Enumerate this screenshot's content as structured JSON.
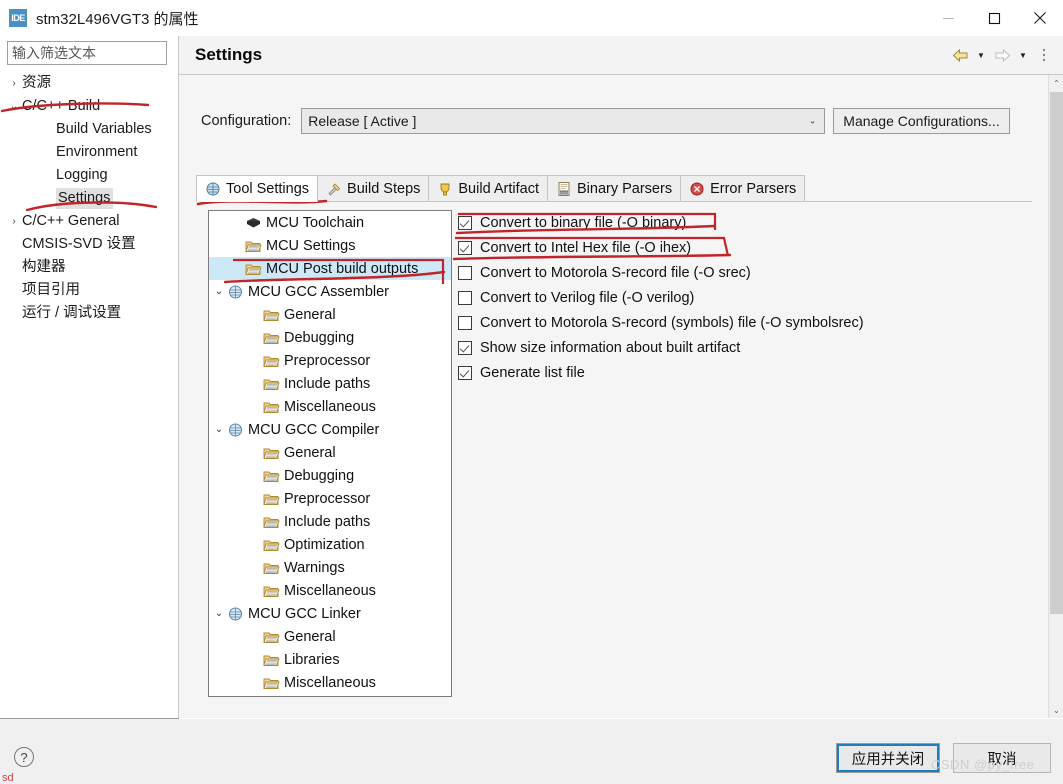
{
  "window": {
    "title": "stm32L496VGT3 的属性",
    "app_icon": "ide-icon",
    "icon_text": "IDE",
    "controls": {
      "minimize": "minimize-icon",
      "maximize": "maximize-icon",
      "close": "close-icon"
    }
  },
  "filter": {
    "placeholder": "输入筛选文本",
    "value": ""
  },
  "sidebar": {
    "items": [
      {
        "label": "资源",
        "twisty": "›",
        "indent": 0,
        "selected": false
      },
      {
        "label": "C/C++ Build",
        "twisty": "⌄",
        "indent": 0,
        "selected": false
      },
      {
        "label": "Build Variables",
        "twisty": "",
        "indent": 1,
        "selected": false
      },
      {
        "label": "Environment",
        "twisty": "",
        "indent": 1,
        "selected": false
      },
      {
        "label": "Logging",
        "twisty": "",
        "indent": 1,
        "selected": false
      },
      {
        "label": "Settings",
        "twisty": "",
        "indent": 1,
        "selected": true
      },
      {
        "label": "C/C++ General",
        "twisty": "›",
        "indent": 0,
        "selected": false
      },
      {
        "label": "CMSIS-SVD 设置",
        "twisty": "",
        "indent": 0,
        "selected": false
      },
      {
        "label": "构建器",
        "twisty": "",
        "indent": 0,
        "selected": false
      },
      {
        "label": "项目引用",
        "twisty": "",
        "indent": 0,
        "selected": false
      },
      {
        "label": "运行 / 调试设置",
        "twisty": "",
        "indent": 0,
        "selected": false
      }
    ]
  },
  "header": {
    "title": "Settings",
    "tools": [
      "back-arrow-icon",
      "back-dropdown-icon",
      "forward-arrow-icon",
      "forward-dropdown-icon",
      "view-menu-icon"
    ]
  },
  "configuration": {
    "label": "Configuration:",
    "value": "Release  [ Active ]",
    "manage_button": "Manage Configurations..."
  },
  "tabs": [
    {
      "label": "Tool Settings",
      "icon": "tool-settings-icon",
      "active": true
    },
    {
      "label": "Build Steps",
      "icon": "build-steps-icon",
      "active": false
    },
    {
      "label": "Build Artifact",
      "icon": "build-artifact-icon",
      "active": false
    },
    {
      "label": "Binary Parsers",
      "icon": "binary-parsers-icon",
      "active": false
    },
    {
      "label": "Error Parsers",
      "icon": "error-parsers-icon",
      "active": false
    }
  ],
  "tool_tree": [
    {
      "label": "MCU Toolchain",
      "twisty": "",
      "indent": 1,
      "icon": "chip-icon",
      "selected": false
    },
    {
      "label": "MCU Settings",
      "twisty": "",
      "indent": 1,
      "icon": "folder-icon",
      "selected": false
    },
    {
      "label": "MCU Post build outputs",
      "twisty": "",
      "indent": 1,
      "icon": "folder-icon",
      "selected": true
    },
    {
      "label": "MCU GCC Assembler",
      "twisty": "⌄",
      "indent": 0,
      "icon": "gcc-icon",
      "selected": false
    },
    {
      "label": "General",
      "twisty": "",
      "indent": 2,
      "icon": "folder-icon",
      "selected": false
    },
    {
      "label": "Debugging",
      "twisty": "",
      "indent": 2,
      "icon": "folder-icon",
      "selected": false
    },
    {
      "label": "Preprocessor",
      "twisty": "",
      "indent": 2,
      "icon": "folder-icon",
      "selected": false
    },
    {
      "label": "Include paths",
      "twisty": "",
      "indent": 2,
      "icon": "folder-icon",
      "selected": false
    },
    {
      "label": "Miscellaneous",
      "twisty": "",
      "indent": 2,
      "icon": "folder-icon",
      "selected": false
    },
    {
      "label": "MCU GCC Compiler",
      "twisty": "⌄",
      "indent": 0,
      "icon": "gcc-icon",
      "selected": false
    },
    {
      "label": "General",
      "twisty": "",
      "indent": 2,
      "icon": "folder-icon",
      "selected": false
    },
    {
      "label": "Debugging",
      "twisty": "",
      "indent": 2,
      "icon": "folder-icon",
      "selected": false
    },
    {
      "label": "Preprocessor",
      "twisty": "",
      "indent": 2,
      "icon": "folder-icon",
      "selected": false
    },
    {
      "label": "Include paths",
      "twisty": "",
      "indent": 2,
      "icon": "folder-icon",
      "selected": false
    },
    {
      "label": "Optimization",
      "twisty": "",
      "indent": 2,
      "icon": "folder-icon",
      "selected": false
    },
    {
      "label": "Warnings",
      "twisty": "",
      "indent": 2,
      "icon": "folder-icon",
      "selected": false
    },
    {
      "label": "Miscellaneous",
      "twisty": "",
      "indent": 2,
      "icon": "folder-icon",
      "selected": false
    },
    {
      "label": "MCU GCC Linker",
      "twisty": "⌄",
      "indent": 0,
      "icon": "gcc-icon",
      "selected": false
    },
    {
      "label": "General",
      "twisty": "",
      "indent": 2,
      "icon": "folder-icon",
      "selected": false
    },
    {
      "label": "Libraries",
      "twisty": "",
      "indent": 2,
      "icon": "folder-icon",
      "selected": false
    },
    {
      "label": "Miscellaneous",
      "twisty": "",
      "indent": 2,
      "icon": "folder-icon",
      "selected": false
    }
  ],
  "options": [
    {
      "label": "Convert to binary file (-O binary)",
      "checked": true
    },
    {
      "label": "Convert to Intel Hex file (-O ihex)",
      "checked": true
    },
    {
      "label": "Convert to Motorola S-record file (-O srec)",
      "checked": false
    },
    {
      "label": "Convert to Verilog file (-O verilog)",
      "checked": false
    },
    {
      "label": "Convert to Motorola S-record (symbols) file (-O symbolsrec)",
      "checked": false
    },
    {
      "label": "Show size information about built artifact",
      "checked": true
    },
    {
      "label": "Generate list file",
      "checked": true
    }
  ],
  "footer": {
    "help": "?",
    "apply_button": "应用并关闭",
    "cancel_button": "取消",
    "note": "sd",
    "watermark": "CSDN @py_free"
  },
  "colors": {
    "annotation": "#c0252b",
    "selection": "#cde8f7",
    "accent": "#1a7fc1",
    "folder": "#e9b44c"
  }
}
